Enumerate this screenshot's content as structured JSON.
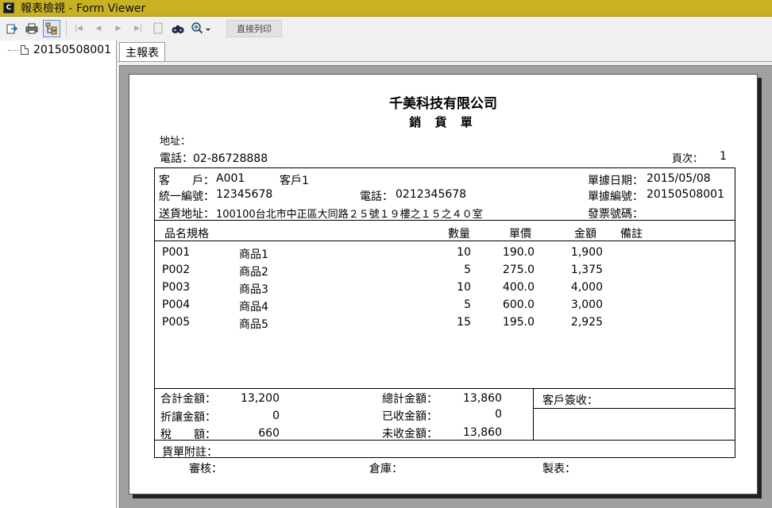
{
  "window": {
    "title": "報表檢視 - Form Viewer",
    "icon_letter": "C"
  },
  "toolbar": {
    "buttons": [
      "export-icon",
      "print-icon",
      "tree-toggle-icon",
      "first-page-icon",
      "prev-page-icon",
      "next-page-icon",
      "last-page-icon",
      "page-icon",
      "find-icon",
      "zoom-icon"
    ],
    "print_direct": "直接列印"
  },
  "tree": {
    "item": "20150508001"
  },
  "tabs": {
    "main": "主報表"
  },
  "report": {
    "company": "千美科技有限公司",
    "title": "銷 貨 單",
    "address_label": "地址：",
    "phone": "電話：02-86728888",
    "page_label": "頁次：",
    "page_number": "1",
    "customer_label": "客　　戶：",
    "customer_code": "A001",
    "customer_name": "客戶1",
    "tax_id_label": "統一編號：",
    "tax_id": "12345678",
    "cust_phone_label": "電話：",
    "cust_phone": "0212345678",
    "ship_addr_label": "送貨地址：",
    "ship_addr": "100100台北市中正區大同路２５號１９樓之１５之４０室",
    "doc_date_label": "單據日期：",
    "doc_date": "2015/05/08",
    "doc_no_label": "單據編號：",
    "doc_no": "20150508001",
    "invoice_label": "發票號碼：",
    "invoice_no": "",
    "columns": {
      "item": "品名規格",
      "qty": "數量",
      "price": "單價",
      "amount": "金額",
      "note": "備註"
    },
    "rows": [
      {
        "code": "P001",
        "name": "商品1",
        "qty": "10",
        "price": "190.0",
        "amount": "1,900"
      },
      {
        "code": "P002",
        "name": "商品2",
        "qty": "5",
        "price": "275.0",
        "amount": "1,375"
      },
      {
        "code": "P003",
        "name": "商品3",
        "qty": "10",
        "price": "400.0",
        "amount": "4,000"
      },
      {
        "code": "P004",
        "name": "商品4",
        "qty": "5",
        "price": "600.0",
        "amount": "3,000"
      },
      {
        "code": "P005",
        "name": "商品5",
        "qty": "15",
        "price": "195.0",
        "amount": "2,925"
      }
    ],
    "totals": {
      "subtotal_label": "合計金額：",
      "subtotal": "13,200",
      "discount_label": "折讓金額：",
      "discount": "0",
      "tax_label": "稅　　額：",
      "tax": "660",
      "grand_label": "總計金額：",
      "grand": "13,860",
      "received_label": "已收金額：",
      "received": "0",
      "unpaid_label": "未收金額：",
      "unpaid": "13,860",
      "signature_label": "客戶簽收："
    },
    "remark_label": "貨單附註：",
    "footer": {
      "review": "審核：",
      "warehouse": "倉庫：",
      "maker": "製表："
    }
  }
}
